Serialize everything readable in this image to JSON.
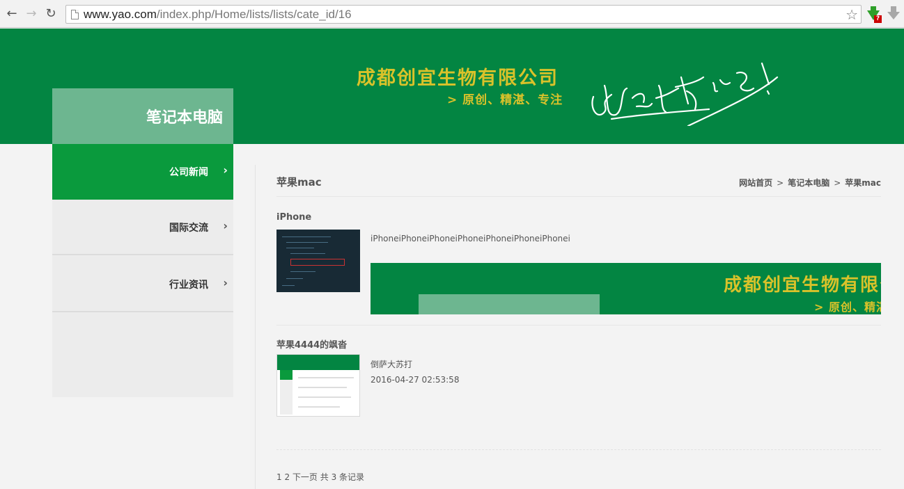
{
  "browser": {
    "url_host": "www.yao.com",
    "url_path": "/index.php/Home/lists/lists/cate_id/16"
  },
  "header": {
    "company_name": "成都创宜生物有限公司",
    "slogan": "> 原创、精湛、专注"
  },
  "sidebar": {
    "title": "笔记本电脑",
    "items": [
      {
        "label": "公司新闻",
        "active": true
      },
      {
        "label": "国际交流",
        "active": false
      },
      {
        "label": "行业资讯",
        "active": false
      }
    ],
    "chevron": "›"
  },
  "content": {
    "title": "苹果mac",
    "breadcrumb": [
      "网站首页",
      "笔记本电脑",
      "苹果mac"
    ],
    "breadcrumb_sep": ">",
    "articles": [
      {
        "title": "iPhone",
        "excerpt": "iPhoneiPhoneiPhoneiPhoneiPhoneiPhoneiPhonei",
        "banner_name": "成都创宜生物有限公司",
        "banner_slogan": "> 原创、精湛、专注"
      },
      {
        "title": "苹果4444的飒沓",
        "excerpt": "倒萨大苏打",
        "date": "2016-04-27 02:53:58"
      }
    ],
    "pagination": {
      "pages": "1 2",
      "next": "下一页",
      "total": "共 3 条记录"
    }
  },
  "colors": {
    "brand_green": "#038542",
    "active_green": "#0a9a3d",
    "light_green": "#6db690",
    "gold": "#d9c22a"
  },
  "icons": [
    "back-arrow-icon",
    "forward-arrow-icon",
    "reload-icon",
    "page-icon",
    "star-icon",
    "download-extension-icon",
    "download-icon"
  ]
}
